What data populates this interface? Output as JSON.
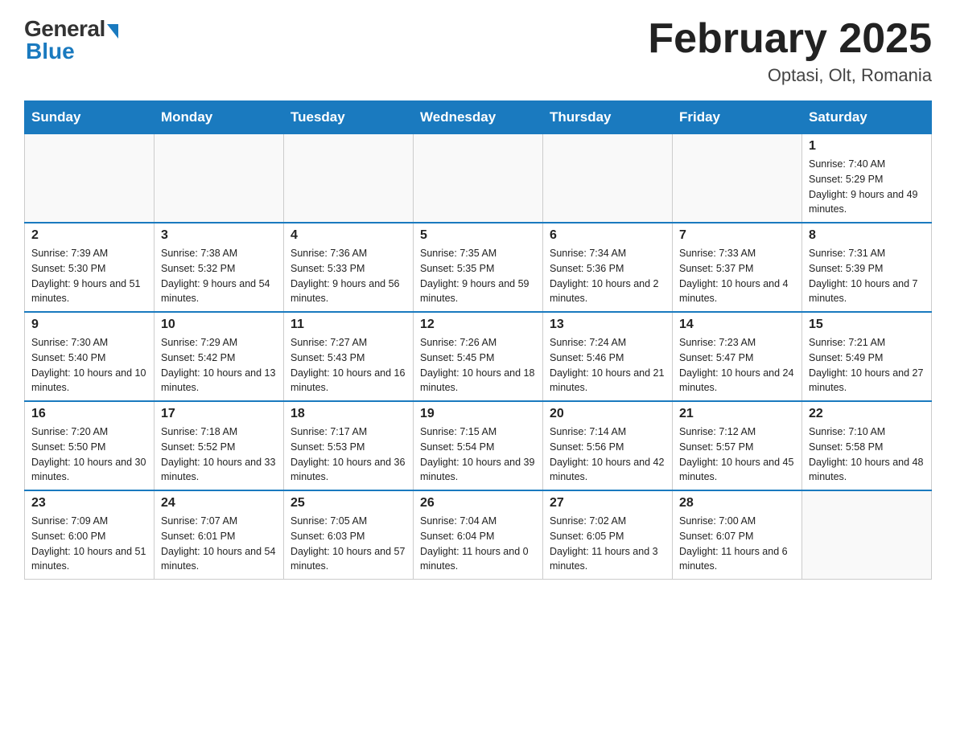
{
  "logo": {
    "general": "General",
    "blue": "Blue"
  },
  "title": {
    "month": "February 2025",
    "location": "Optasi, Olt, Romania"
  },
  "days_of_week": [
    "Sunday",
    "Monday",
    "Tuesday",
    "Wednesday",
    "Thursday",
    "Friday",
    "Saturday"
  ],
  "weeks": [
    [
      {
        "day": "",
        "info": ""
      },
      {
        "day": "",
        "info": ""
      },
      {
        "day": "",
        "info": ""
      },
      {
        "day": "",
        "info": ""
      },
      {
        "day": "",
        "info": ""
      },
      {
        "day": "",
        "info": ""
      },
      {
        "day": "1",
        "info": "Sunrise: 7:40 AM\nSunset: 5:29 PM\nDaylight: 9 hours and 49 minutes."
      }
    ],
    [
      {
        "day": "2",
        "info": "Sunrise: 7:39 AM\nSunset: 5:30 PM\nDaylight: 9 hours and 51 minutes."
      },
      {
        "day": "3",
        "info": "Sunrise: 7:38 AM\nSunset: 5:32 PM\nDaylight: 9 hours and 54 minutes."
      },
      {
        "day": "4",
        "info": "Sunrise: 7:36 AM\nSunset: 5:33 PM\nDaylight: 9 hours and 56 minutes."
      },
      {
        "day": "5",
        "info": "Sunrise: 7:35 AM\nSunset: 5:35 PM\nDaylight: 9 hours and 59 minutes."
      },
      {
        "day": "6",
        "info": "Sunrise: 7:34 AM\nSunset: 5:36 PM\nDaylight: 10 hours and 2 minutes."
      },
      {
        "day": "7",
        "info": "Sunrise: 7:33 AM\nSunset: 5:37 PM\nDaylight: 10 hours and 4 minutes."
      },
      {
        "day": "8",
        "info": "Sunrise: 7:31 AM\nSunset: 5:39 PM\nDaylight: 10 hours and 7 minutes."
      }
    ],
    [
      {
        "day": "9",
        "info": "Sunrise: 7:30 AM\nSunset: 5:40 PM\nDaylight: 10 hours and 10 minutes."
      },
      {
        "day": "10",
        "info": "Sunrise: 7:29 AM\nSunset: 5:42 PM\nDaylight: 10 hours and 13 minutes."
      },
      {
        "day": "11",
        "info": "Sunrise: 7:27 AM\nSunset: 5:43 PM\nDaylight: 10 hours and 16 minutes."
      },
      {
        "day": "12",
        "info": "Sunrise: 7:26 AM\nSunset: 5:45 PM\nDaylight: 10 hours and 18 minutes."
      },
      {
        "day": "13",
        "info": "Sunrise: 7:24 AM\nSunset: 5:46 PM\nDaylight: 10 hours and 21 minutes."
      },
      {
        "day": "14",
        "info": "Sunrise: 7:23 AM\nSunset: 5:47 PM\nDaylight: 10 hours and 24 minutes."
      },
      {
        "day": "15",
        "info": "Sunrise: 7:21 AM\nSunset: 5:49 PM\nDaylight: 10 hours and 27 minutes."
      }
    ],
    [
      {
        "day": "16",
        "info": "Sunrise: 7:20 AM\nSunset: 5:50 PM\nDaylight: 10 hours and 30 minutes."
      },
      {
        "day": "17",
        "info": "Sunrise: 7:18 AM\nSunset: 5:52 PM\nDaylight: 10 hours and 33 minutes."
      },
      {
        "day": "18",
        "info": "Sunrise: 7:17 AM\nSunset: 5:53 PM\nDaylight: 10 hours and 36 minutes."
      },
      {
        "day": "19",
        "info": "Sunrise: 7:15 AM\nSunset: 5:54 PM\nDaylight: 10 hours and 39 minutes."
      },
      {
        "day": "20",
        "info": "Sunrise: 7:14 AM\nSunset: 5:56 PM\nDaylight: 10 hours and 42 minutes."
      },
      {
        "day": "21",
        "info": "Sunrise: 7:12 AM\nSunset: 5:57 PM\nDaylight: 10 hours and 45 minutes."
      },
      {
        "day": "22",
        "info": "Sunrise: 7:10 AM\nSunset: 5:58 PM\nDaylight: 10 hours and 48 minutes."
      }
    ],
    [
      {
        "day": "23",
        "info": "Sunrise: 7:09 AM\nSunset: 6:00 PM\nDaylight: 10 hours and 51 minutes."
      },
      {
        "day": "24",
        "info": "Sunrise: 7:07 AM\nSunset: 6:01 PM\nDaylight: 10 hours and 54 minutes."
      },
      {
        "day": "25",
        "info": "Sunrise: 7:05 AM\nSunset: 6:03 PM\nDaylight: 10 hours and 57 minutes."
      },
      {
        "day": "26",
        "info": "Sunrise: 7:04 AM\nSunset: 6:04 PM\nDaylight: 11 hours and 0 minutes."
      },
      {
        "day": "27",
        "info": "Sunrise: 7:02 AM\nSunset: 6:05 PM\nDaylight: 11 hours and 3 minutes."
      },
      {
        "day": "28",
        "info": "Sunrise: 7:00 AM\nSunset: 6:07 PM\nDaylight: 11 hours and 6 minutes."
      },
      {
        "day": "",
        "info": ""
      }
    ]
  ]
}
